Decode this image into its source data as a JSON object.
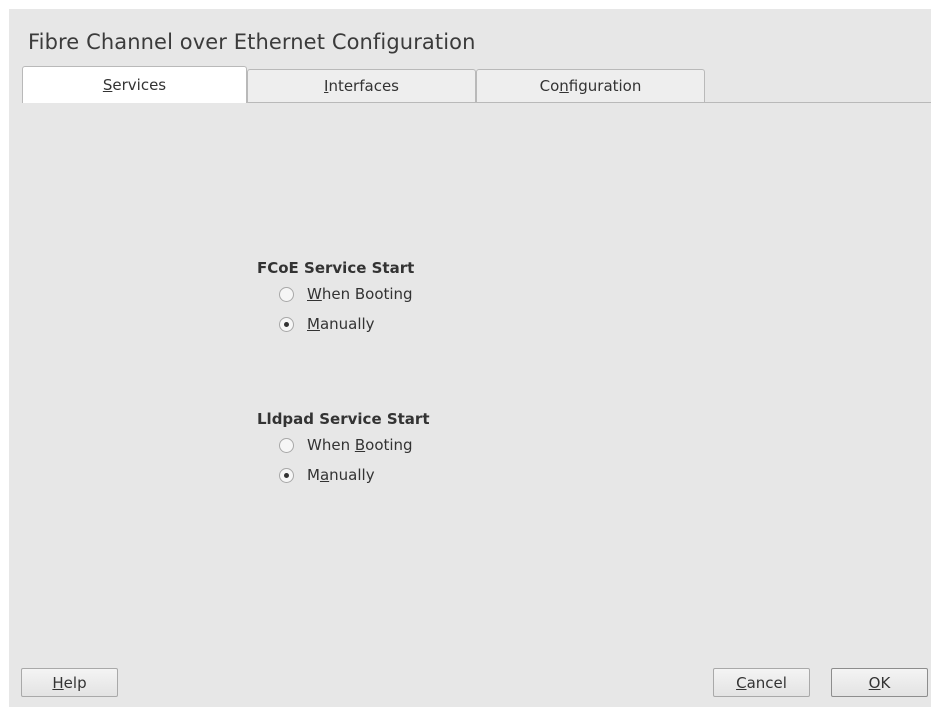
{
  "window": {
    "title": "Fibre Channel over Ethernet Configuration"
  },
  "tabs": [
    {
      "label": "Services",
      "mnemonic_index": 0,
      "active": true
    },
    {
      "label": "Interfaces",
      "mnemonic_index": 0,
      "active": false
    },
    {
      "label": "Configuration",
      "mnemonic_index": 2,
      "active": false
    }
  ],
  "fcoe": {
    "title": "FCoE Service Start",
    "options": [
      {
        "label": "When Booting",
        "mnemonic_index": 0,
        "selected": false
      },
      {
        "label": "Manually",
        "mnemonic_index": 0,
        "selected": true
      }
    ]
  },
  "lldpad": {
    "title": "Lldpad Service Start",
    "options": [
      {
        "label": "When Booting",
        "mnemonic_index": 5,
        "selected": false
      },
      {
        "label": "Manually",
        "mnemonic_index": 1,
        "selected": true
      }
    ]
  },
  "buttons": {
    "help": {
      "label": "Help",
      "mnemonic_index": 0
    },
    "cancel": {
      "label": "Cancel",
      "mnemonic_index": 0
    },
    "ok": {
      "label": "OK",
      "mnemonic_index": 0
    }
  },
  "colors": {
    "background": "#e7e7e7",
    "active_tab": "#ffffff",
    "border": "#b9b9b9",
    "text": "#333333"
  }
}
